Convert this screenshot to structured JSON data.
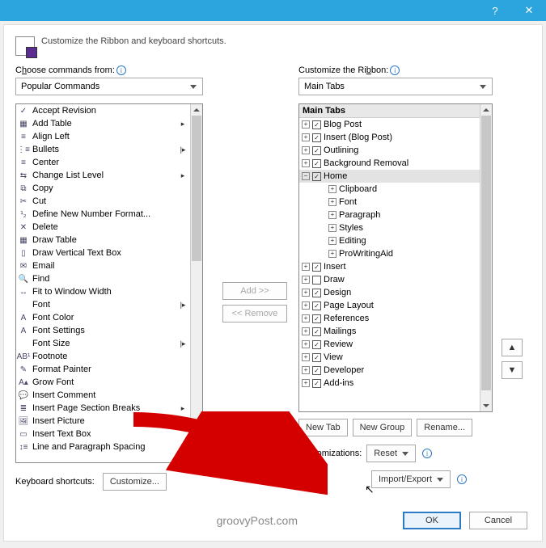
{
  "titlebar": {
    "help_icon": "?",
    "close_icon": "✕"
  },
  "header": {
    "text": "Customize the Ribbon and keyboard shortcuts."
  },
  "left": {
    "choose_label_pre": "C",
    "choose_label_hot": "h",
    "choose_label_post": "oose commands from:",
    "combo_value": "Popular Commands",
    "items": [
      {
        "ico": "✓",
        "t": "Accept Revision"
      },
      {
        "ico": "▦",
        "t": "Add Table",
        "sub": "▸"
      },
      {
        "ico": "≡",
        "t": "Align Left"
      },
      {
        "ico": "⋮≡",
        "t": "Bullets",
        "sub": "|▸"
      },
      {
        "ico": "≡",
        "t": "Center"
      },
      {
        "ico": "⇆",
        "t": "Change List Level",
        "sub": "▸"
      },
      {
        "ico": "⧉",
        "t": "Copy"
      },
      {
        "ico": "✂",
        "t": "Cut"
      },
      {
        "ico": "¹₂",
        "t": "Define New Number Format..."
      },
      {
        "ico": "✕",
        "t": "Delete"
      },
      {
        "ico": "▦",
        "t": "Draw Table"
      },
      {
        "ico": "▯",
        "t": "Draw Vertical Text Box"
      },
      {
        "ico": "✉",
        "t": "Email"
      },
      {
        "ico": "🔍",
        "t": "Find"
      },
      {
        "ico": "↔",
        "t": "Fit to Window Width"
      },
      {
        "ico": "",
        "t": "Font",
        "sub": "|▸"
      },
      {
        "ico": "A",
        "t": "Font Color"
      },
      {
        "ico": "A",
        "t": "Font Settings"
      },
      {
        "ico": "",
        "t": "Font Size",
        "sub": "|▸"
      },
      {
        "ico": "AB¹",
        "t": "Footnote"
      },
      {
        "ico": "✎",
        "t": "Format Painter"
      },
      {
        "ico": "A▴",
        "t": "Grow Font"
      },
      {
        "ico": "💬",
        "t": "Insert Comment"
      },
      {
        "ico": "≣",
        "t": "Insert Page  Section Breaks",
        "sub": "▸"
      },
      {
        "ico": "🖼",
        "t": "Insert Picture"
      },
      {
        "ico": "▭",
        "t": "Insert Text Box"
      },
      {
        "ico": "↕≡",
        "t": "Line and Paragraph Spacing",
        "sub": "▸"
      }
    ],
    "kb_label": "Keyboard shortcuts:",
    "kb_button": "Customize..."
  },
  "mid": {
    "add": "Add >>",
    "remove": "<< Remove"
  },
  "right": {
    "label_pre": "Customize the Ri",
    "label_hot": "b",
    "label_post": "bon:",
    "combo_value": "Main Tabs",
    "header": "Main Tabs",
    "tree": [
      {
        "d": 1,
        "exp": "+",
        "chk": true,
        "t": "Blog Post"
      },
      {
        "d": 1,
        "exp": "+",
        "chk": true,
        "t": "Insert (Blog Post)"
      },
      {
        "d": 1,
        "exp": "+",
        "chk": true,
        "t": "Outlining"
      },
      {
        "d": 1,
        "exp": "+",
        "chk": true,
        "t": "Background Removal"
      },
      {
        "d": 1,
        "exp": "−",
        "chk": true,
        "t": "Home",
        "sel": true
      },
      {
        "d": 2,
        "exp": "+",
        "t": "Clipboard"
      },
      {
        "d": 2,
        "exp": "+",
        "t": "Font"
      },
      {
        "d": 2,
        "exp": "+",
        "t": "Paragraph"
      },
      {
        "d": 2,
        "exp": "+",
        "t": "Styles"
      },
      {
        "d": 2,
        "exp": "+",
        "t": "Editing"
      },
      {
        "d": 2,
        "exp": "+",
        "t": "ProWritingAid"
      },
      {
        "d": 1,
        "exp": "+",
        "chk": true,
        "t": "Insert"
      },
      {
        "d": 1,
        "exp": "+",
        "chk": false,
        "t": "Draw"
      },
      {
        "d": 1,
        "exp": "+",
        "chk": true,
        "t": "Design"
      },
      {
        "d": 1,
        "exp": "+",
        "chk": true,
        "t": "Page Layout"
      },
      {
        "d": 1,
        "exp": "+",
        "chk": true,
        "t": "References"
      },
      {
        "d": 1,
        "exp": "+",
        "chk": true,
        "t": "Mailings"
      },
      {
        "d": 1,
        "exp": "+",
        "chk": true,
        "t": "Review"
      },
      {
        "d": 1,
        "exp": "+",
        "chk": true,
        "t": "View"
      },
      {
        "d": 1,
        "exp": "+",
        "chk": true,
        "t": "Developer"
      },
      {
        "d": 1,
        "exp": "+",
        "chk": true,
        "t": "Add-ins"
      }
    ],
    "new_tab": "New Tab",
    "new_group": "New Group",
    "rename": "Rename...",
    "cust_label": "Customizations:",
    "reset": "Reset",
    "import_export": "Import/Export",
    "up": "▲",
    "down": "▼"
  },
  "footer": {
    "watermark": "groovyPost.com",
    "ok": "OK",
    "cancel": "Cancel"
  }
}
